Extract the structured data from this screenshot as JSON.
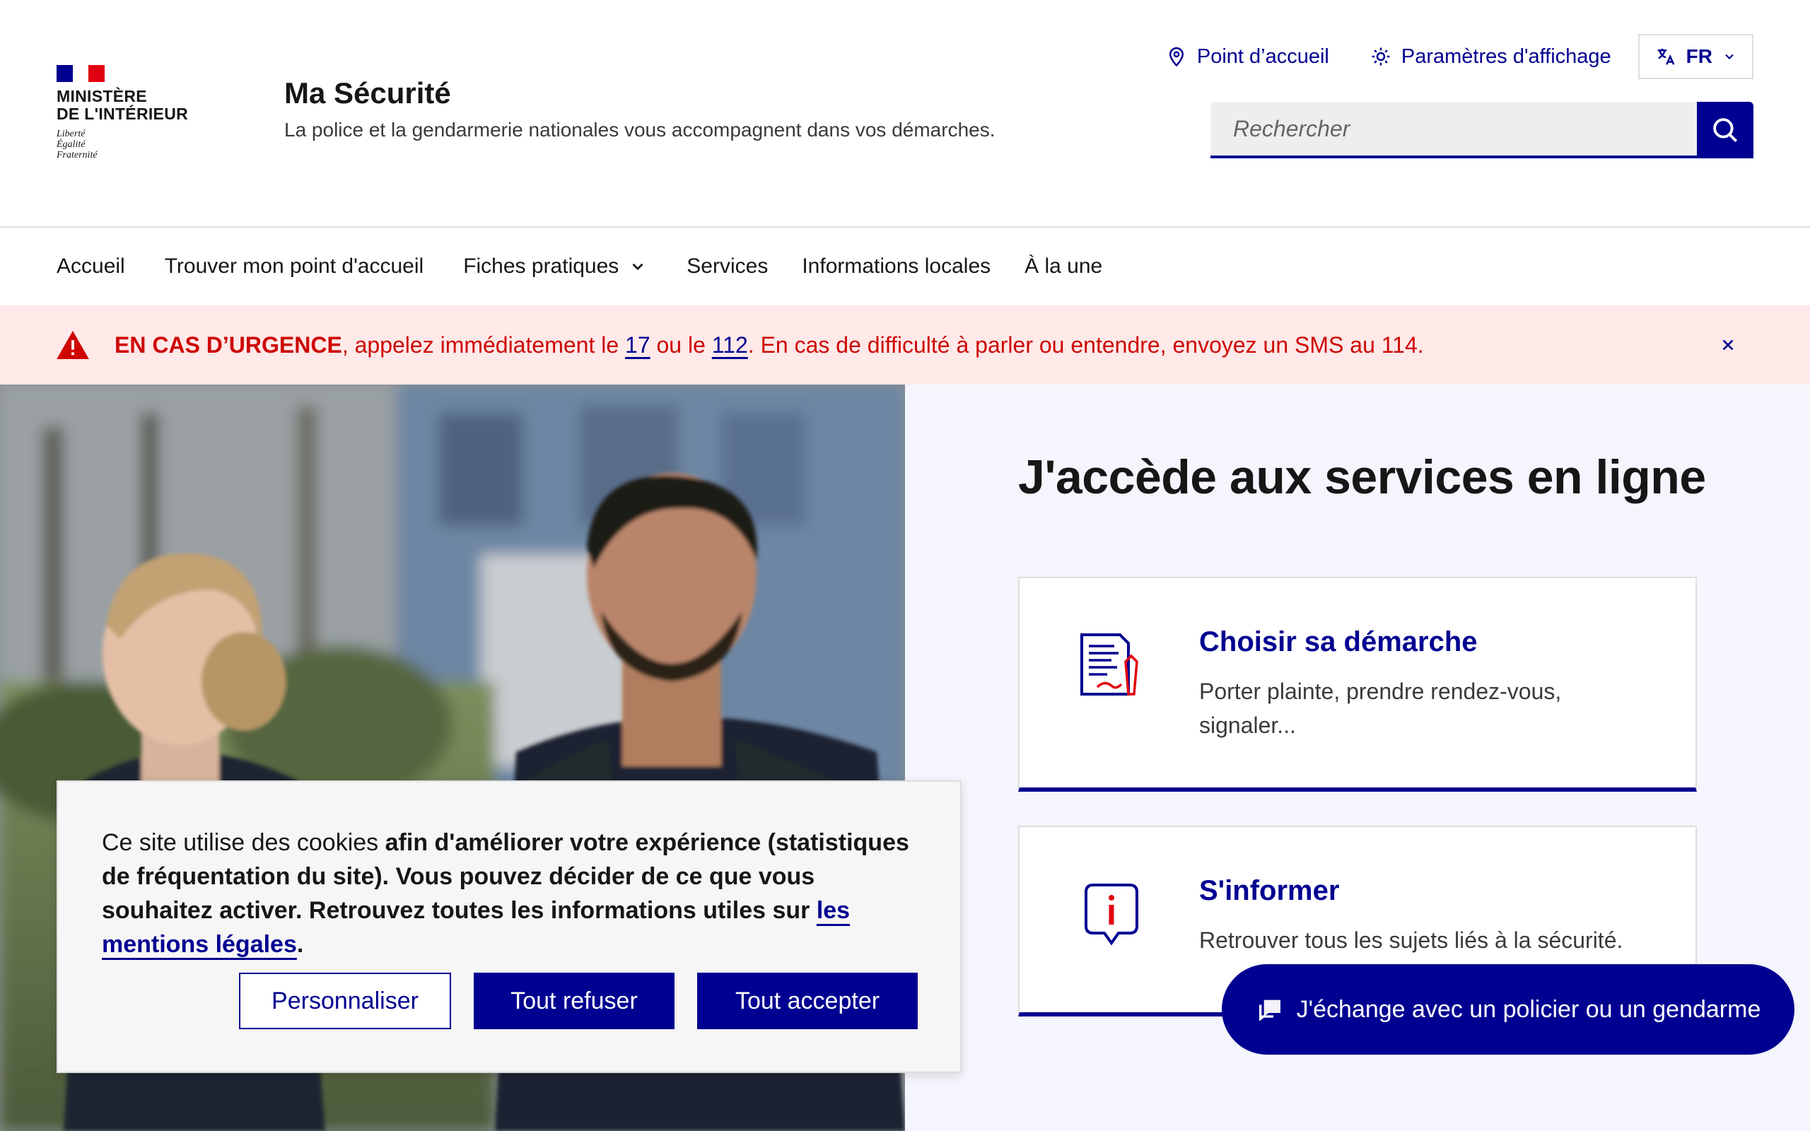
{
  "header": {
    "logo_text": "Ministère\nde l'Intérieur",
    "logo_motto": "Liberté\nÉgalité\nFraternité",
    "site_title": "Ma Sécurité",
    "tagline": "La police et la gendarmerie nationales vous accompagnent dans vos démarches.",
    "tools": {
      "point_accueil": "Point d’accueil",
      "display_settings": "Paramètres d'affichage",
      "language": "FR"
    },
    "search": {
      "placeholder": "Rechercher"
    }
  },
  "nav": {
    "items": [
      {
        "label": "Accueil"
      },
      {
        "label": "Trouver mon point d'accueil"
      },
      {
        "label": "Fiches pratiques"
      },
      {
        "label": "Services"
      },
      {
        "label": "Informations locales"
      },
      {
        "label": "À la une"
      }
    ]
  },
  "alert": {
    "strong": "EN CAS D’URGENCE",
    "part1": ", appelez immédiatement le ",
    "num1": "17",
    "part2": " ou le ",
    "num2": "112",
    "part3": ". En cas de difficulté à parler ou entendre, envoyez un SMS au 114."
  },
  "hero": {
    "title": "J'accède aux services en ligne",
    "cards": [
      {
        "title": "Choisir sa démarche",
        "desc": "Porter plainte, prendre rendez-vous, signaler..."
      },
      {
        "title": "S'informer",
        "desc": "Retrouver tous les sujets liés à la sécurité."
      }
    ],
    "chat_button": "J'échange avec un policier ou un gendarme"
  },
  "cookie": {
    "text_plain": "Ce site utilise des cookies ",
    "text_bold": "afin d'améliorer votre expérience (statistiques de fréquentation du site). Vous pouvez décider de ce que vous souhaitez activer. Retrouvez toutes les informations utiles sur ",
    "link": "les mentions légales",
    "end": ".",
    "buttons": {
      "customize": "Personnaliser",
      "refuse": "Tout refuser",
      "accept": "Tout accepter"
    }
  },
  "colors": {
    "brand_blue": "#000091",
    "alert_red": "#ce0500",
    "alert_bg": "#ffe9e9",
    "hero_bg": "#f5f5fe"
  }
}
